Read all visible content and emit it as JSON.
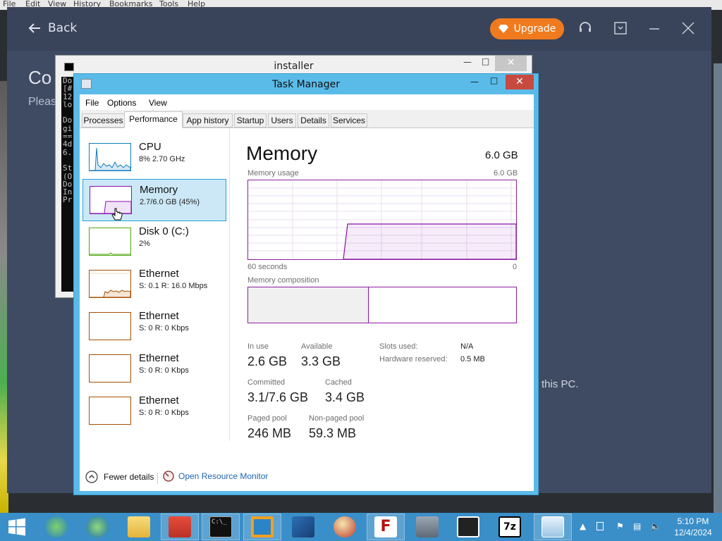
{
  "browser_menu": {
    "items": [
      "File",
      "Edit",
      "View",
      "History",
      "Bookmarks",
      "Tools",
      "Help"
    ]
  },
  "installer_app": {
    "back_label": "Back",
    "upgrade_label": "Upgrade",
    "heading_partial": "Co",
    "subtext_partial": "Pleas",
    "pc_text_partial": "this PC.",
    "accent_color": "#f07b1e"
  },
  "installer_window": {
    "title": "installer",
    "console_lines": [
      "Do",
      "[#",
      "12",
      "lo",
      "",
      "Do",
      "gi",
      "==",
      "4d",
      "6.",
      "",
      "St",
      "(O",
      "Do",
      "In",
      "Pr"
    ]
  },
  "task_manager": {
    "title": "Task Manager",
    "menu": [
      "File",
      "Options",
      "View"
    ],
    "tabs": [
      "Processes",
      "Performance",
      "App history",
      "Startup",
      "Users",
      "Details",
      "Services"
    ],
    "active_tab": "Performance",
    "resources": [
      {
        "name": "CPU",
        "stat": "8%  2.70 GHz",
        "color": "#117dbb"
      },
      {
        "name": "Memory",
        "stat": "2.7/6.0 GB (45%)",
        "color": "#8b12ae",
        "selected": true
      },
      {
        "name": "Disk 0 (C:)",
        "stat": "2%",
        "color": "#4da60c"
      },
      {
        "name": "Ethernet",
        "stat": "S: 0.1  R: 16.0 Mbps",
        "color": "#a74f01"
      },
      {
        "name": "Ethernet",
        "stat": "S: 0  R: 0 Kbps",
        "color": "#a74f01"
      },
      {
        "name": "Ethernet",
        "stat": "S: 0  R: 0 Kbps",
        "color": "#a74f01"
      },
      {
        "name": "Ethernet",
        "stat": "S: 0  R: 0 Kbps",
        "color": "#a74f01"
      }
    ],
    "memory": {
      "title": "Memory",
      "total": "6.0 GB",
      "usage_label": "Memory usage",
      "usage_max": "6.0 GB",
      "time_left": "60 seconds",
      "time_right": "0",
      "composition_label": "Memory composition",
      "in_use_fraction": 0.45,
      "stats": {
        "in_use_label": "In use",
        "in_use": "2.6 GB",
        "available_label": "Available",
        "available": "3.3 GB",
        "committed_label": "Committed",
        "committed": "3.1/7.6 GB",
        "cached_label": "Cached",
        "cached": "3.4 GB",
        "paged_label": "Paged pool",
        "paged": "246 MB",
        "nonpaged_label": "Non-paged pool",
        "nonpaged": "59.3 MB",
        "slots_label": "Slots used:",
        "slots": "N/A",
        "hw_label": "Hardware reserved:",
        "hw": "0.5 MB"
      }
    },
    "footer": {
      "fewer_details": "Fewer details",
      "open_monitor": "Open Resource Monitor"
    }
  },
  "taskbar": {
    "apps": [
      "Internet Explorer",
      "Internet Explorer",
      "File Explorer",
      "Toolbox",
      "Command Prompt",
      "Installer",
      "VirtualBox",
      "Network Tool",
      "FileZilla",
      "Device Manager",
      "Remote Desktop",
      "7-Zip",
      "Task Manager"
    ],
    "time": "5:10 PM",
    "date": "12/4/2024"
  }
}
